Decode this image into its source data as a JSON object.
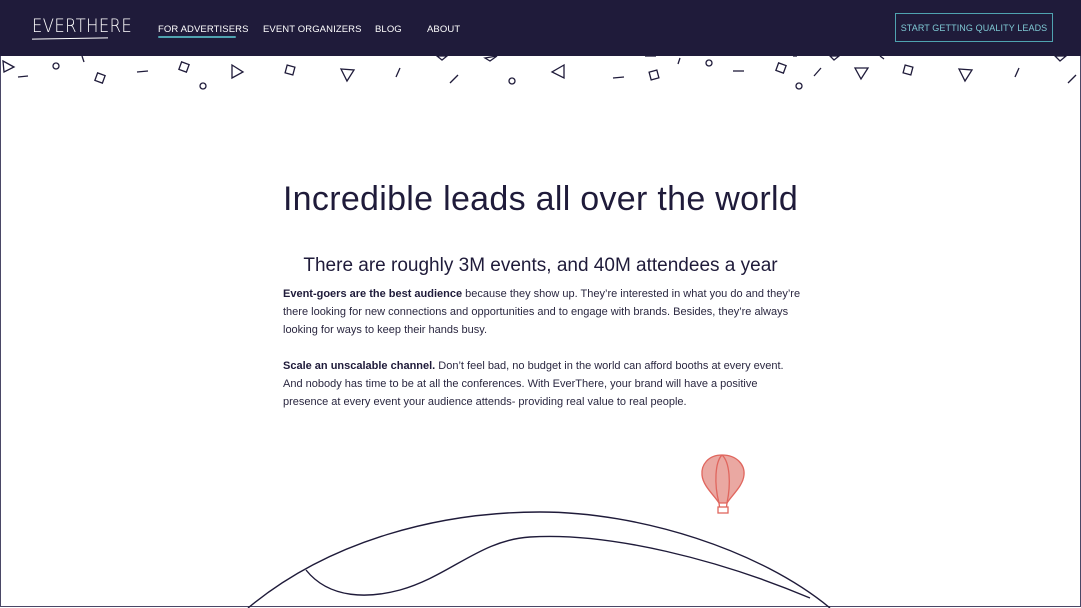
{
  "header": {
    "logo_text": "EVERTHERE",
    "nav": [
      {
        "label": "FOR ADVERTISERS",
        "active": true
      },
      {
        "label": "EVENT ORGANIZERS",
        "active": false
      },
      {
        "label": "BLOG",
        "active": false
      },
      {
        "label": "ABOUT",
        "active": false
      }
    ],
    "cta_label": "START GETTING QUALITY LEADS"
  },
  "hero": {
    "title": "Incredible leads all over the world",
    "subtitle": "There are roughly 3M events, and 40M attendees a year"
  },
  "content": {
    "p1_bold": "Event-goers are the best audience",
    "p1_rest": " because they show up.  They’re interested in what you do and they’re there looking for new connections and opportunities and to engage with brands. Besides, they’re always looking for ways to keep their hands busy.",
    "p2_bold": "Scale an unscalable channel.",
    "p2_rest": " Don’t feel bad, no budget in the world can afford booths at every event. And nobody has time to be at all the conferences.  With EverThere, your brand will have a positive presence at every event your audience attends- providing real value to real people."
  },
  "colors": {
    "navy": "#1f1b3a",
    "teal": "#4fa3b0",
    "balloon": "#e0665e"
  },
  "icons": {
    "confetti": "confetti-pattern",
    "balloon": "hot-air-balloon-icon",
    "globe": "globe-illustration"
  }
}
